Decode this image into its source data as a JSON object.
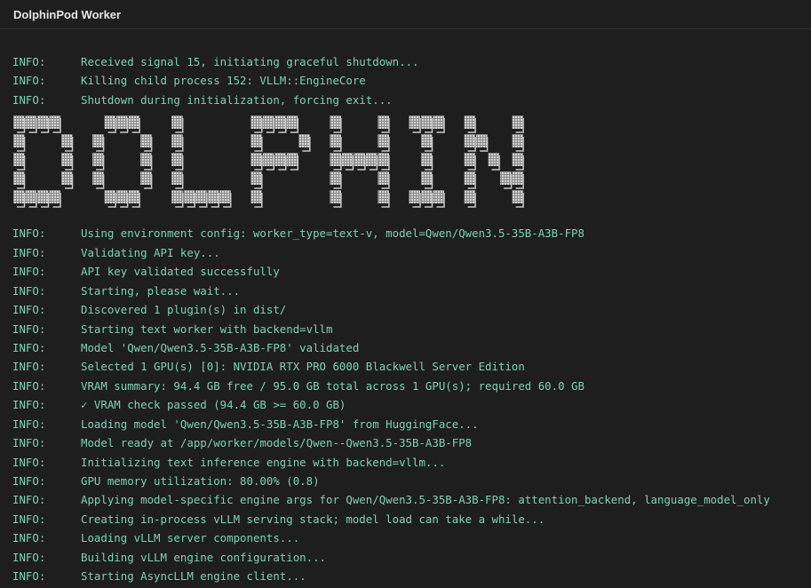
{
  "window": {
    "title": "DolphinPod Worker"
  },
  "colors": {
    "background": "#1e1e1e",
    "log_text": "#7fd1b9",
    "title_text": "#e6e6e6"
  },
  "banner": {
    "style": "block-letter ascii art logo",
    "text": "DOLPHIN"
  },
  "logs_before_banner": [
    {
      "level": "INFO:",
      "message": "Received signal 15, initiating graceful shutdown..."
    },
    {
      "level": "INFO:",
      "message": "Killing child process 152: VLLM::EngineCore"
    },
    {
      "level": "INFO:",
      "message": "Shutdown during initialization, forcing exit..."
    }
  ],
  "logs_after_banner": [
    {
      "level": "INFO:",
      "message": "Using environment config: worker_type=text-v, model=Qwen/Qwen3.5-35B-A3B-FP8"
    },
    {
      "level": "INFO:",
      "message": "Validating API key..."
    },
    {
      "level": "INFO:",
      "message": "API key validated successfully"
    },
    {
      "level": "INFO:",
      "message": "Starting, please wait..."
    },
    {
      "level": "INFO:",
      "message": "Discovered 1 plugin(s) in dist/"
    },
    {
      "level": "INFO:",
      "message": "Starting text worker with backend=vllm"
    },
    {
      "level": "INFO:",
      "message": "Model 'Qwen/Qwen3.5-35B-A3B-FP8' validated"
    },
    {
      "level": "INFO:",
      "message": "Selected 1 GPU(s) [0]: NVIDIA RTX PRO 6000 Blackwell Server Edition"
    },
    {
      "level": "INFO:",
      "message": "VRAM summary: 94.4 GB free / 95.0 GB total across 1 GPU(s); required 60.0 GB"
    },
    {
      "level": "INFO:",
      "message": "✓ VRAM check passed (94.4 GB >= 60.0 GB)"
    },
    {
      "level": "INFO:",
      "message": "Loading model 'Qwen/Qwen3.5-35B-A3B-FP8' from HuggingFace..."
    },
    {
      "level": "INFO:",
      "message": "Model ready at /app/worker/models/Qwen--Qwen3.5-35B-A3B-FP8"
    },
    {
      "level": "INFO:",
      "message": "Initializing text inference engine with backend=vllm..."
    },
    {
      "level": "INFO:",
      "message": "GPU memory utilization: 80.00% (0.8)"
    },
    {
      "level": "INFO:",
      "message": "Applying model-specific engine args for Qwen/Qwen3.5-35B-A3B-FP8: attention_backend, language_model_only"
    },
    {
      "level": "INFO:",
      "message": "Creating in-process vLLM serving stack; model load can take a while..."
    },
    {
      "level": "INFO:",
      "message": "Loading vLLM server components..."
    },
    {
      "level": "INFO:",
      "message": "Building vLLM engine configuration..."
    },
    {
      "level": "INFO:",
      "message": "Starting AsyncLLM engine client..."
    }
  ]
}
